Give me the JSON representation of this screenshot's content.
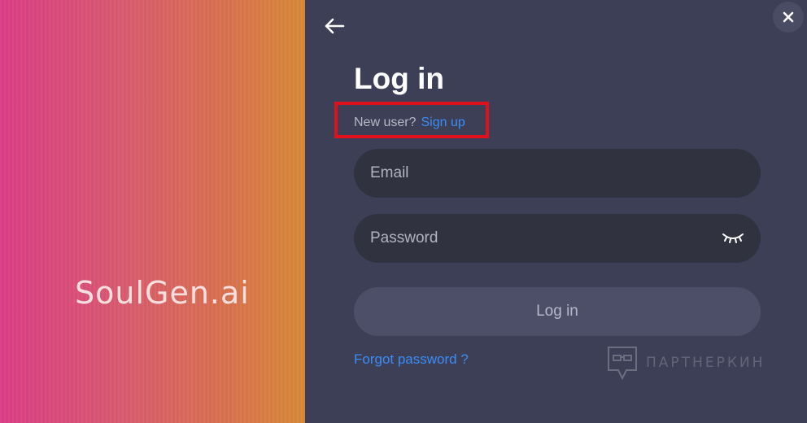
{
  "brand": {
    "logo_text": "SoulGen.ai"
  },
  "header": {
    "back_icon": "arrow-left-icon",
    "close_icon": "close-icon"
  },
  "form": {
    "title": "Log in",
    "new_user_text": "New user?",
    "sign_up_link": "Sign up",
    "email": {
      "placeholder": "Email",
      "value": ""
    },
    "password": {
      "placeholder": "Password",
      "value": "",
      "toggle_icon": "eye-closed-icon"
    },
    "login_button": "Log in",
    "forgot_password": "Forgot password ?"
  },
  "watermark": {
    "text": "ПАРТНЕРКИН"
  },
  "colors": {
    "panel_bg": "#3d3f56",
    "field_bg": "#30323f",
    "button_bg": "#4d4f69",
    "link": "#3b8df5",
    "highlight": "#e0101c"
  }
}
